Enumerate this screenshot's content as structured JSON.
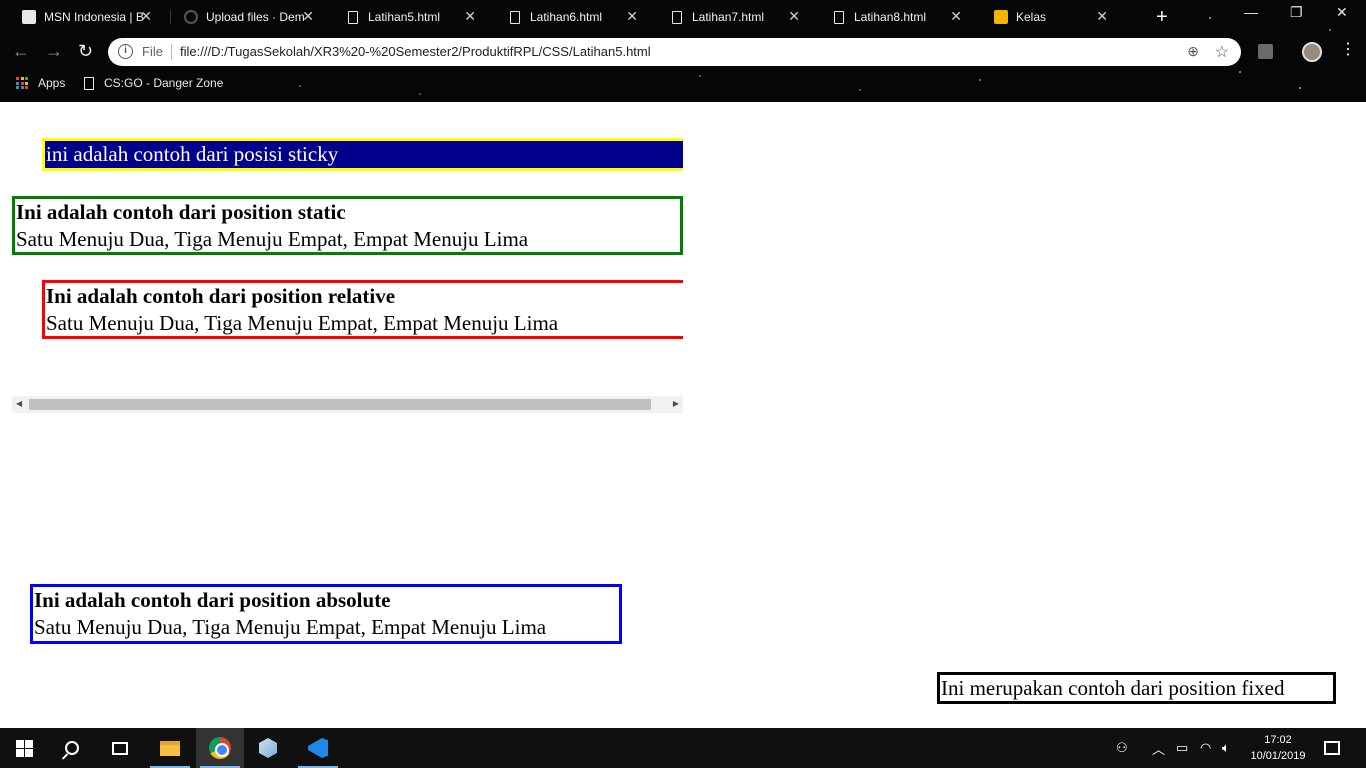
{
  "browser": {
    "tabs": [
      {
        "label": "MSN Indonesia | B",
        "icon": "msn-icon"
      },
      {
        "label": "Upload files · Dem",
        "icon": "upload-icon"
      },
      {
        "label": "Latihan5.html",
        "icon": "document-icon"
      },
      {
        "label": "Latihan6.html",
        "icon": "document-icon"
      },
      {
        "label": "Latihan7.html",
        "icon": "document-icon"
      },
      {
        "label": "Latihan8.html",
        "icon": "document-icon"
      },
      {
        "label": "Kelas",
        "icon": "classroom-icon"
      }
    ],
    "active_tab": 2,
    "address": {
      "scheme_label": "File",
      "url": "file:///D:/TugasSekolah/XR3%20-%20Semester2/ProduktifRPL/CSS/Latihan5.html"
    },
    "bookmarks": [
      {
        "label": "Apps",
        "icon": "apps-grid-icon"
      },
      {
        "label": "CS:GO - Danger Zone",
        "icon": "document-icon"
      }
    ]
  },
  "page": {
    "sticky": "ini adalah contoh dari posisi sticky",
    "static": {
      "heading": "Ini adalah contoh dari position static",
      "text": "Satu Menuju Dua, Tiga Menuju Empat, Empat Menuju Lima"
    },
    "relative": {
      "heading": "Ini adalah contoh dari position relative",
      "text": "Satu Menuju Dua, Tiga Menuju Empat, Empat Menuju Lima"
    },
    "absolute": {
      "heading": "Ini adalah contoh dari position absolute",
      "text": "Satu Menuju Dua, Tiga Menuju Empat, Empat Menuju Lima"
    },
    "fixed": "Ini merupakan contoh dari position fixed"
  },
  "colors": {
    "sticky_bg": "#00008b",
    "sticky_border": "#ffff00",
    "static_border": "#008000",
    "relative_border": "#ff0000",
    "absolute_border": "#0000ff",
    "fixed_border": "#000000"
  },
  "taskbar": {
    "time": "17:02",
    "date": "10/01/2019",
    "apps": [
      "start-icon",
      "search-icon",
      "task-view-icon",
      "file-explorer-icon",
      "chrome-icon",
      "3d-cube-icon",
      "vscode-icon"
    ]
  }
}
